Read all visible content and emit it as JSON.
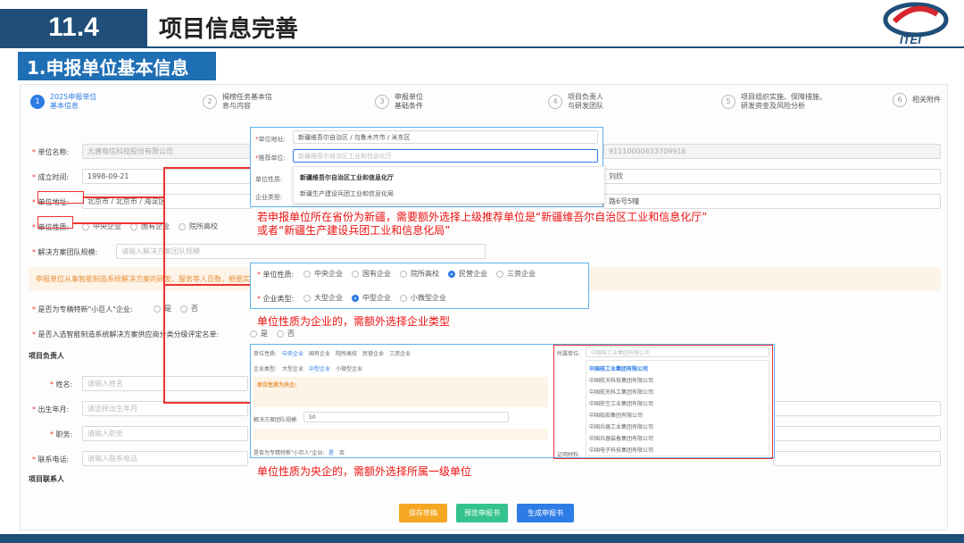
{
  "header": {
    "number": "11.4",
    "title": "项目信息完善",
    "logo_text": "ITEI"
  },
  "section_title": "1.申报单位基本信息",
  "steps": [
    {
      "num": "1",
      "label": "2025申报单位\n基本信息"
    },
    {
      "num": "2",
      "label": "揭榜任务基本信\n息与内容"
    },
    {
      "num": "3",
      "label": "申报单位\n基础条件"
    },
    {
      "num": "4",
      "label": "项目负责人\n与研发团队"
    },
    {
      "num": "5",
      "label": "项目组织实施、保障措施、\n研发资金及风险分析"
    },
    {
      "num": "6",
      "label": "相关附件"
    }
  ],
  "form": {
    "unit_name_label": "单位名称:",
    "unit_name_value": "大唐电信科技股份有限公司",
    "credit_code_value": "91110000633709916",
    "founded_label": "成立时间:",
    "founded_value": "1998-09-21",
    "contact_value": "刘欣",
    "address_label": "单位地址:",
    "address_value": "北京市 / 北京市 / 海淀区",
    "address_detail": "路6号5幢",
    "nature_label": "单位性质:",
    "nature_options": [
      "中央企业",
      "国有企业",
      "院所高校",
      "民营企业",
      "三资企业"
    ],
    "team_label": "解决方案团队规模:",
    "team_placeholder": "请输入解决方案团队规模",
    "notice_text": "申报单位从事智能制造系统解决方案的研发、服务等人员数，根据实际情况填写",
    "little_giant_label": "是否为专精特新\"小巨人\"企业:",
    "yes": "是",
    "no": "否",
    "listed_label": "是否入选智能制造系统解决方案供应商分类分级评定名单:",
    "leader_section": "项目负责人",
    "name_label": "姓名:",
    "name_ph": "请输入姓名",
    "birth_label": "出生年月:",
    "birth_ph": "请选择出生年月",
    "job_label": "职务:",
    "job_ph": "请输入职务",
    "phone_label": "联系电话:",
    "phone_ph": "请输入联系电话",
    "contact_section": "项目联系人"
  },
  "overlay1": {
    "addr_label": "单位地址:",
    "addr_value": "新疆维吾尔自治区 / 乌鲁木齐市 / 米东区",
    "rec_label": "推荐单位:",
    "rec_ph": "新疆维吾尔自治区工业和信息化厅",
    "nature_label": "单位性质:",
    "type_label": "企业类型:",
    "options": [
      "新疆维吾尔自治区工业和信息化厅",
      "新疆生产建设兵团工业和信息化局"
    ]
  },
  "overlay2": {
    "nature_label": "单位性质:",
    "nature_options": [
      "中央企业",
      "国有企业",
      "院所高校",
      "民营企业",
      "三资企业"
    ],
    "type_label": "企业类型:",
    "type_options": [
      "大型企业",
      "中型企业",
      "小微型企业"
    ]
  },
  "overlay3": {
    "nature_label": "单位性质:",
    "nature_options": [
      "中央企业",
      "国有企业",
      "院所高校",
      "民营企业",
      "三资企业"
    ],
    "type_label": "企业类型:",
    "type_options": [
      "大型企业",
      "中型企业",
      "小微型企业"
    ],
    "notice_title": "单位性质为央企:",
    "team_label": "解决方案团队规模:",
    "team_value": "50",
    "lg_label": "是否为专精特新\"小巨人\"企业:",
    "yes": "是",
    "no": "否",
    "parent_label": "所属单位:",
    "parent_ph": "中国核工业集团有限公司",
    "parent_options": [
      "中国核工业集团有限公司",
      "中国航天科技集团有限公司",
      "中国航天科工集团有限公司",
      "中国航空工业集团有限公司",
      "中国船舶集团有限公司",
      "中国兵器工业集团有限公司",
      "中国兵器装备集团有限公司",
      "中国电子科技集团有限公司"
    ],
    "cert_label": "证明材料:"
  },
  "annotations": {
    "a1_line1": "若申报单位所在省份为新疆，需要额外选择上级推荐单位是“新疆维吾尔自治区工业和信息化厅”",
    "a1_line2": "或者“新疆生产建设兵团工业和信息化局”",
    "a2": "单位性质为企业的，需额外选择企业类型",
    "a3": "单位性质为央企的，需额外选择所属一级单位"
  },
  "buttons": {
    "save": "保存草稿",
    "preview": "预览申报书",
    "generate": "生成申报书"
  },
  "colors": {
    "brand": "#1f4e79",
    "accent": "#2d7ce6",
    "annotation": "#e11111",
    "save": "#f5a623",
    "preview": "#34c38f",
    "generate": "#2d7ce6"
  }
}
